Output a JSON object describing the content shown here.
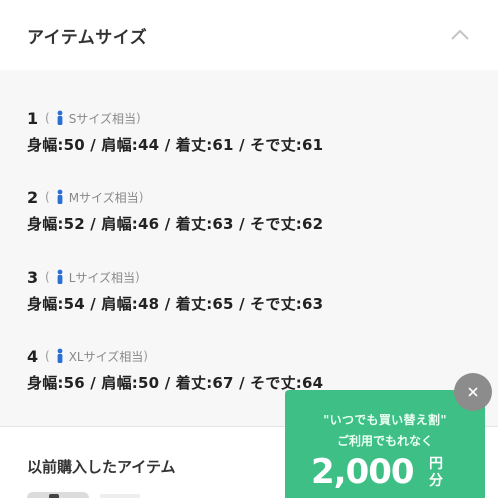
{
  "header": {
    "title": "アイテムサイズ",
    "toggle_icon": "chevron-up-icon"
  },
  "sizes": [
    {
      "number": "1",
      "open": "(",
      "size_label": "Sサイズ相当",
      "close": ")",
      "measurements": "身幅:50 / 肩幅:44 / 着丈:61 / そで丈:61"
    },
    {
      "number": "2",
      "open": "(",
      "size_label": "Mサイズ相当",
      "close": ")",
      "measurements": "身幅:52 / 肩幅:46 / 着丈:63 / そで丈:62"
    },
    {
      "number": "3",
      "open": "(",
      "size_label": "Lサイズ相当",
      "close": ")",
      "measurements": "身幅:54 / 肩幅:48 / 着丈:65 / そで丈:63"
    },
    {
      "number": "4",
      "open": "(",
      "size_label": "XLサイズ相当",
      "close": ")",
      "measurements": "身幅:56 / 肩幅:50 / 着丈:67 / そで丈:64"
    }
  ],
  "person_icon": {
    "name": "person-icon",
    "color": "#2a6fd6"
  },
  "purchased": {
    "title": "以前購入したアイテム"
  },
  "promo": {
    "line1": "\"いつでも買い替え割\"",
    "line2": "ご利用でもれなく",
    "amount": "2,000",
    "unit": "円分",
    "color": "#3dbf86"
  },
  "close_icon": "close-icon"
}
